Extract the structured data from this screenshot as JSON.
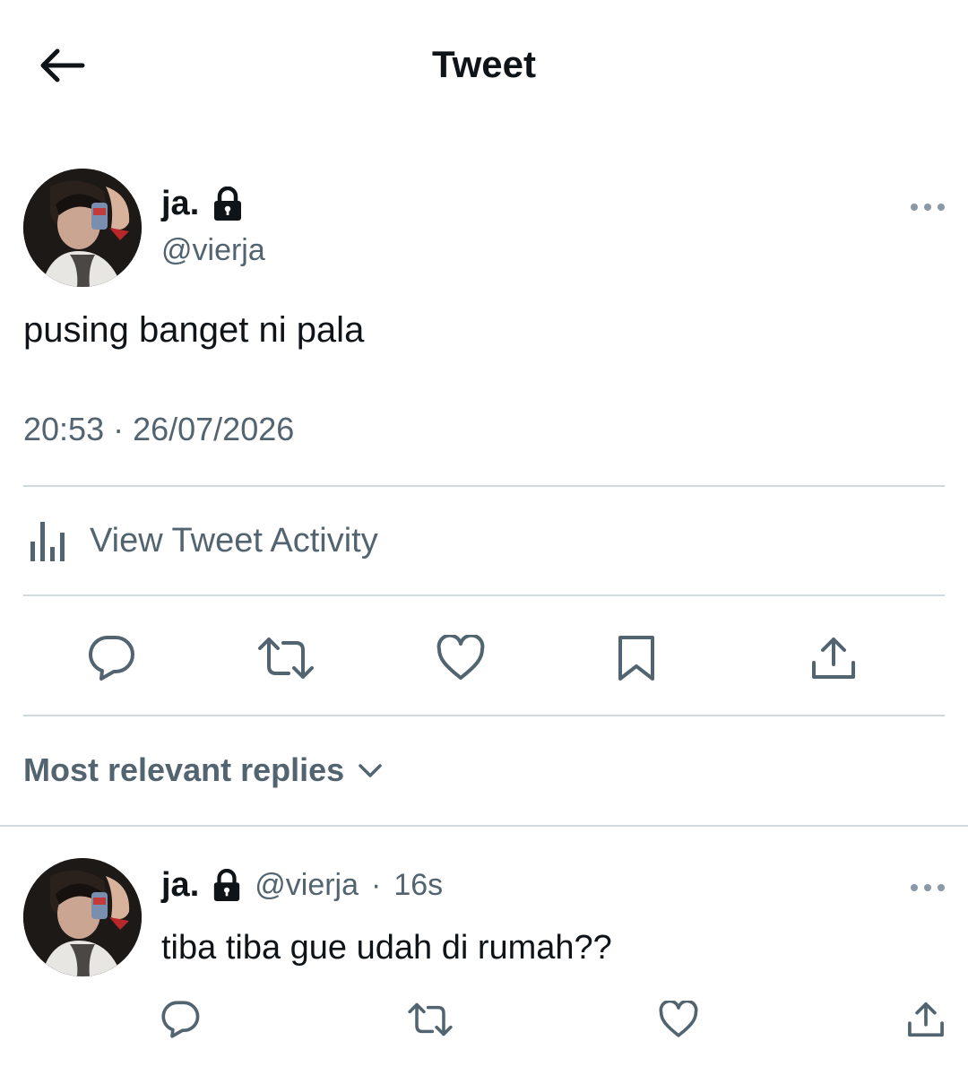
{
  "header": {
    "title": "Tweet"
  },
  "tweet": {
    "display_name": "ja.",
    "handle": "@vierja",
    "text": "pusing banget ni pala",
    "timestamp": "20:53 · 26/07/2026",
    "activity_label": "View Tweet Activity"
  },
  "replies": {
    "sort_label": "Most relevant replies",
    "items": [
      {
        "display_name": "ja.",
        "handle": "@vierja",
        "separator": "·",
        "age": "16s",
        "text": "tiba tiba gue udah di rumah??"
      }
    ]
  },
  "icons": {
    "back": "arrow-left-icon",
    "lock": "lock-icon",
    "more": "more-horizontal-icon",
    "activity": "bar-chart-icon",
    "reply": "comment-icon",
    "retweet": "retweet-icon",
    "like": "heart-icon",
    "bookmark": "bookmark-icon",
    "share": "share-icon",
    "chevron": "chevron-down-icon"
  },
  "colors": {
    "text_primary": "#0f1419",
    "text_secondary": "#536471",
    "divider": "#cfd9de",
    "background": "#ffffff"
  }
}
